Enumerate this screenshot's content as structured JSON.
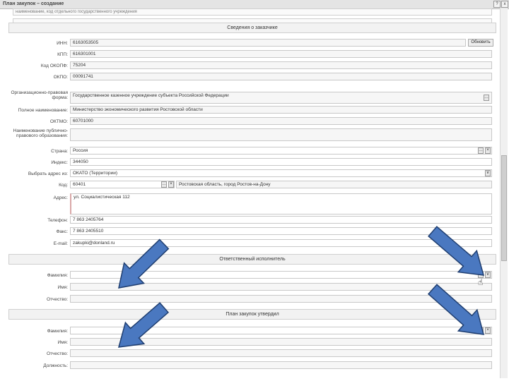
{
  "window": {
    "title": "План закупок – создание",
    "btn_help": "?",
    "btn_close": "x"
  },
  "top_lines": [
    "наименование, код отдельного государственного учреждения",
    ""
  ],
  "sections": {
    "customer": "Сведения о заказчике",
    "responsible": "Ответственный исполнитель",
    "approver": "План закупок утвердил"
  },
  "customer": {
    "inn_label": "ИНН:",
    "inn": "6163053505",
    "refresh_button": "Обновить",
    "kpp_label": "КПП:",
    "kpp": "616301001",
    "okopf_label": "Код ОКОПФ:",
    "okopf": "75204",
    "okpo_label": "ОКПО:",
    "okpo": "00091741",
    "orgform_label": "Организационно-правовая форма:",
    "orgform": "Государственное казенное учреждение субъекта Российской Федерации",
    "fullname_label": "Полное наименование:",
    "fullname": "Министерство экономического развития Ростовской области",
    "oktmo_label": "ОКТМО:",
    "oktmo": "60701000",
    "publicname_label": "Наименование публично-правового образования:",
    "publicname": "",
    "country_label": "Страна:",
    "country": "Россия",
    "index_label": "Индекс:",
    "index": "344050",
    "addrselect_label": "Выбрать адрес из:",
    "addrselect": "ОКАТО (Территории)",
    "code_label": "Код:",
    "code": "60401",
    "code_text": "Ростовская область, город Ростов-на-Дону",
    "address_label": "Адрес:",
    "address": "ул. Социалистическая 112",
    "phone_label": "Телефон:",
    "phone": "7 863 2405764",
    "fax_label": "Факс:",
    "fax": "7 863 2405510",
    "email_label": "E-mail:",
    "email": "zakupki@donland.ru"
  },
  "responsible": {
    "lastname_label": "Фамилия:",
    "firstname_label": "Имя:",
    "patronymic_label": "Отчество:"
  },
  "approver": {
    "lastname_label": "Фамилия:",
    "firstname_label": "Имя:",
    "patronymic_label": "Отчество:",
    "position_label": "Должность:"
  },
  "icons": {
    "ellipsis": "…",
    "dropdown": "∨",
    "clear": "×"
  },
  "colors": {
    "arrow_fill": "#4a78c0",
    "arrow_stroke": "#1f3e70"
  }
}
